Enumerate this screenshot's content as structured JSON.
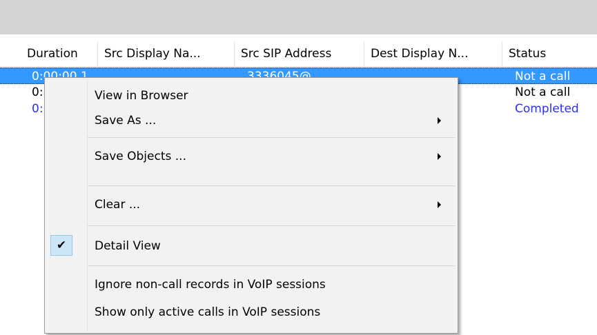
{
  "table": {
    "columns": [
      "Duration",
      "Src Display Na...",
      "Src SIP Address",
      "Dest Display N...",
      "Status"
    ],
    "rows": [
      {
        "duration": "0:00:00.1",
        "src_sip": "3336045@...",
        "status": "Not a call"
      },
      {
        "duration": "0:",
        "status": "Not a call"
      },
      {
        "duration": "0:",
        "status": "Completed"
      }
    ]
  },
  "context_menu": {
    "view_in_browser": "View in Browser",
    "save_as": "Save As ...",
    "save_objects": "Save Objects ...",
    "clear": "Clear ...",
    "detail_view": "Detail View",
    "detail_view_checked": true,
    "check_mark": "✔",
    "ignore_non_call": "Ignore non-call records in VoIP sessions",
    "show_active_calls": "Show only active calls in VoIP sessions"
  },
  "colors": {
    "selection": "#3399ff",
    "completed_text": "#2d2dff"
  },
  "icons": {
    "submenu_arrow": "chevron-right-icon",
    "check": "checkmark-icon"
  }
}
